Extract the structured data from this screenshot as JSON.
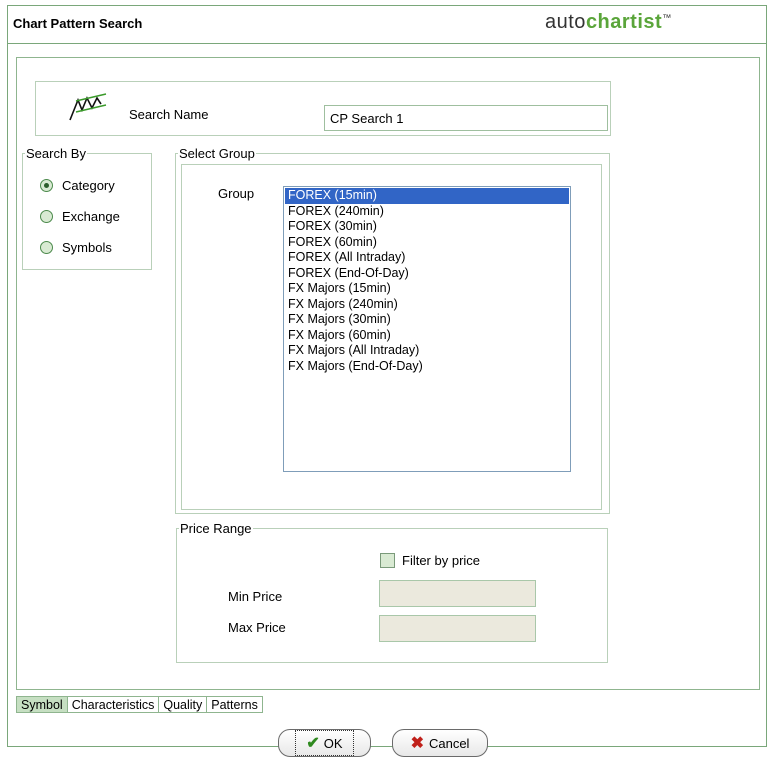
{
  "window": {
    "title": "Chart Pattern Search",
    "logo_part1": "auto",
    "logo_part2": "chartist",
    "logo_tm": "™"
  },
  "search_name": {
    "label": "Search Name",
    "value": "CP Search 1"
  },
  "search_by": {
    "legend": "Search By",
    "options": [
      "Category",
      "Exchange",
      "Symbols"
    ],
    "selected": "Category"
  },
  "select_group": {
    "legend": "Select Group",
    "group_label": "Group",
    "items": [
      "FOREX (15min)",
      "FOREX (240min)",
      "FOREX (30min)",
      "FOREX (60min)",
      "FOREX (All Intraday)",
      "FOREX (End-Of-Day)",
      "FX Majors (15min)",
      "FX Majors (240min)",
      "FX Majors (30min)",
      "FX Majors (60min)",
      "FX Majors (All Intraday)",
      "FX Majors (End-Of-Day)"
    ],
    "selected": "FOREX (15min)"
  },
  "price_range": {
    "legend": "Price Range",
    "filter_label": "Filter by price",
    "filter_checked": false,
    "min_label": "Min Price",
    "max_label": "Max Price",
    "min_value": "",
    "max_value": ""
  },
  "tabs": [
    {
      "label": "Symbol",
      "active": true
    },
    {
      "label": "Characteristics",
      "active": false
    },
    {
      "label": "Quality",
      "active": false
    },
    {
      "label": "Patterns",
      "active": false
    }
  ],
  "buttons": {
    "ok": "OK",
    "cancel": "Cancel"
  },
  "colors": {
    "accent_green": "#5aa53a",
    "selection_blue": "#3165c6"
  }
}
